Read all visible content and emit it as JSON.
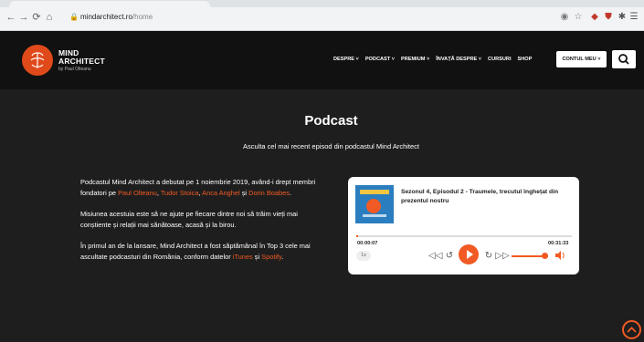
{
  "browser": {
    "url_domain": "mindarchitect.ro",
    "url_path": "/home",
    "back_icon": "arrow-left-icon",
    "forward_icon": "arrow-right-icon",
    "reload_icon": "reload-icon",
    "home_icon": "home-icon"
  },
  "header": {
    "logo_line1": "MIND",
    "logo_line2": "ARCHITECT",
    "logo_sub": "by Paul Olteanu",
    "menu": [
      {
        "label": "DESPRE ˅"
      },
      {
        "label": "PODCAST ˅"
      },
      {
        "label": "PREMIUM ˅"
      },
      {
        "label": "ÎNVAȚĂ DESPRE ˅"
      },
      {
        "label": "CURSURI"
      },
      {
        "label": "SHOP"
      }
    ],
    "account_label": "CONTUL MEU ˅"
  },
  "hero": {
    "title": "Podcast",
    "subtitle": "Asculta cel mai recent episod din podcastul Mind Architect"
  },
  "copy": {
    "p1_a": "Podcastul Mind Architect a debutat pe 1 noiembrie 2019, având-i drept membri fondatori pe ",
    "p1_n1": "Paul Olteanu",
    "p1_s1": ", ",
    "p1_n2": "Tudor Stoica",
    "p1_s2": ", ",
    "p1_n3": "Anca Anghel",
    "p1_s3": " și ",
    "p1_n4": "Dorin Boabes",
    "p1_end": ".",
    "p2": "Misiunea acestuia este să ne ajute pe fiecare dintre noi să trăim vieți mai conștiente și relații mai sănătoase, acasă și la birou.",
    "p3_a": "În primul an de la lansare, Mind Architect a fost săptămânal în Top 3 cele mai ascultate podcasturi din România, conform datelor ",
    "p3_l1": "iTunes",
    "p3_s": " și ",
    "p3_l2": "Spotify",
    "p3_end": "."
  },
  "player": {
    "episode_title": "Sezonul 4, Episodul 2 - Traumele, trecutul înghețat din prezentul nostru",
    "time_elapsed": "00:00:07",
    "time_total": "00:31:33",
    "speed": "1x",
    "progress": 0.004,
    "volume": 0.9
  },
  "colors": {
    "accent": "#f15a24",
    "bg": "#1e1e1e",
    "header": "#111111"
  }
}
